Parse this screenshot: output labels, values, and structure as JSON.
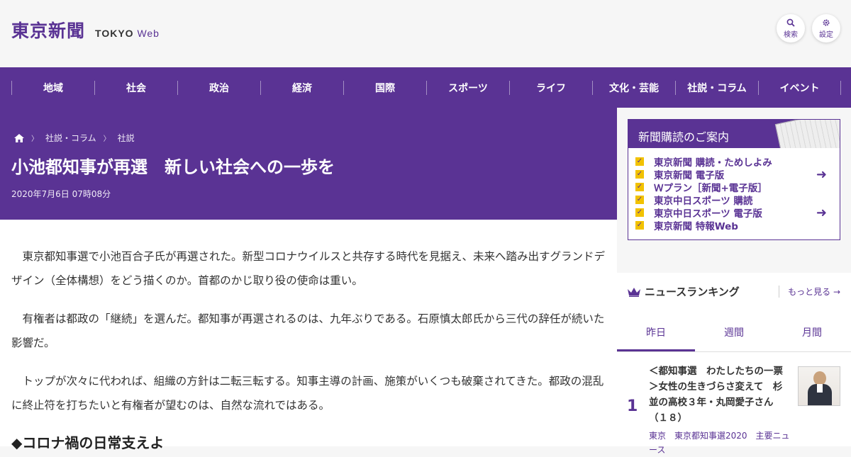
{
  "header": {
    "logo_jp": "東京新聞",
    "logo_en_bold": "TOKYO",
    "logo_en_light": "Web",
    "search_label": "検索",
    "settings_label": "設定",
    "search_icon": "search-icon",
    "settings_icon": "gear-icon"
  },
  "nav": {
    "items": [
      "地域",
      "社会",
      "政治",
      "経済",
      "国際",
      "スポーツ",
      "ライフ",
      "文化・芸能",
      "社説・コラム",
      "イベント"
    ]
  },
  "article": {
    "breadcrumb": [
      "社説・コラム",
      "社説"
    ],
    "title": "小池都知事が再選　新しい社会への一歩を",
    "date": "2020年7月6日 07時08分",
    "paragraphs": [
      "東京都知事選で小池百合子氏が再選された。新型コロナウイルスと共存する時代を見据え、未来へ踏み出すグランドデザイン（全体構想）をどう描くのか。首都のかじ取り役の使命は重い。",
      "有権者は都政の「継続」を選んだ。都知事が再選されるのは、九年ぶりである。石原慎太郎氏から三代の辞任が続いた影響だ。",
      "トップが次々に代われば、組織の方針は二転三転する。知事主導の計画、施策がいくつも破棄されてきた。都政の混乱に終止符を打ちたいと有権者が望むのは、自然な流れではある。"
    ],
    "subheading": "◆コロナ禍の日常支えよ"
  },
  "promo": {
    "heading": "新聞購読のご案内",
    "items": [
      "東京新聞 購読・ためしよみ",
      "東京新聞 電子版",
      "Ｗプラン［新聞+電子版］",
      "東京中日スポーツ 購読",
      "東京中日スポーツ 電子版",
      "東京新聞 特報Web"
    ]
  },
  "ranking": {
    "title": "ニュースランキング",
    "more": "もっと見る",
    "tabs": [
      "昨日",
      "週間",
      "月間"
    ],
    "active_tab": 0,
    "items": [
      {
        "rank": "1",
        "text": "＜都知事選　わたしたちの一票＞女性の生きづらさ変えて　杉並の高校３年・丸岡愛子さん（１８）",
        "tags": "東京　東京都知事選2020　主要ニュース"
      }
    ]
  },
  "colors": {
    "brand": "#5a3394",
    "accent": "#f2c200",
    "background": "#f6f6f6"
  }
}
